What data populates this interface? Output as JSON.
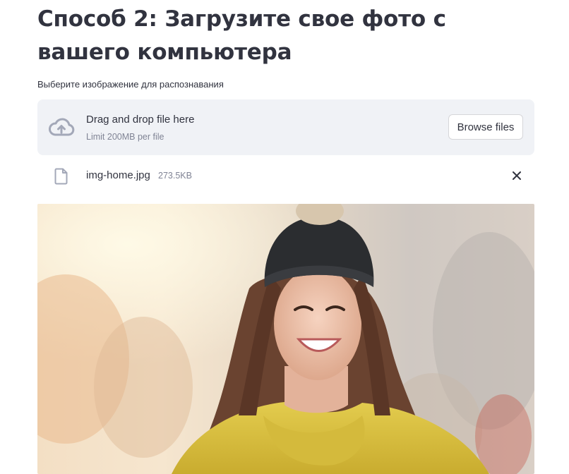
{
  "page": {
    "title": "Способ 2: Загрузите свое фото с вашего компьютера"
  },
  "uploader": {
    "label": "Выберите изображение для распознавания",
    "dropzone_title": "Drag and drop file here",
    "limit_text": "Limit 200MB per file",
    "browse_label": "Browse files",
    "icon": "cloud-upload-icon"
  },
  "uploaded_file": {
    "name": "img-home.jpg",
    "size": "273.5KB",
    "icon": "file-icon",
    "remove_icon": "close-icon"
  },
  "colors": {
    "text": "#31333f",
    "muted": "#808495",
    "dropzone_bg": "#f0f2f6",
    "button_border": "#d6d6d9"
  }
}
